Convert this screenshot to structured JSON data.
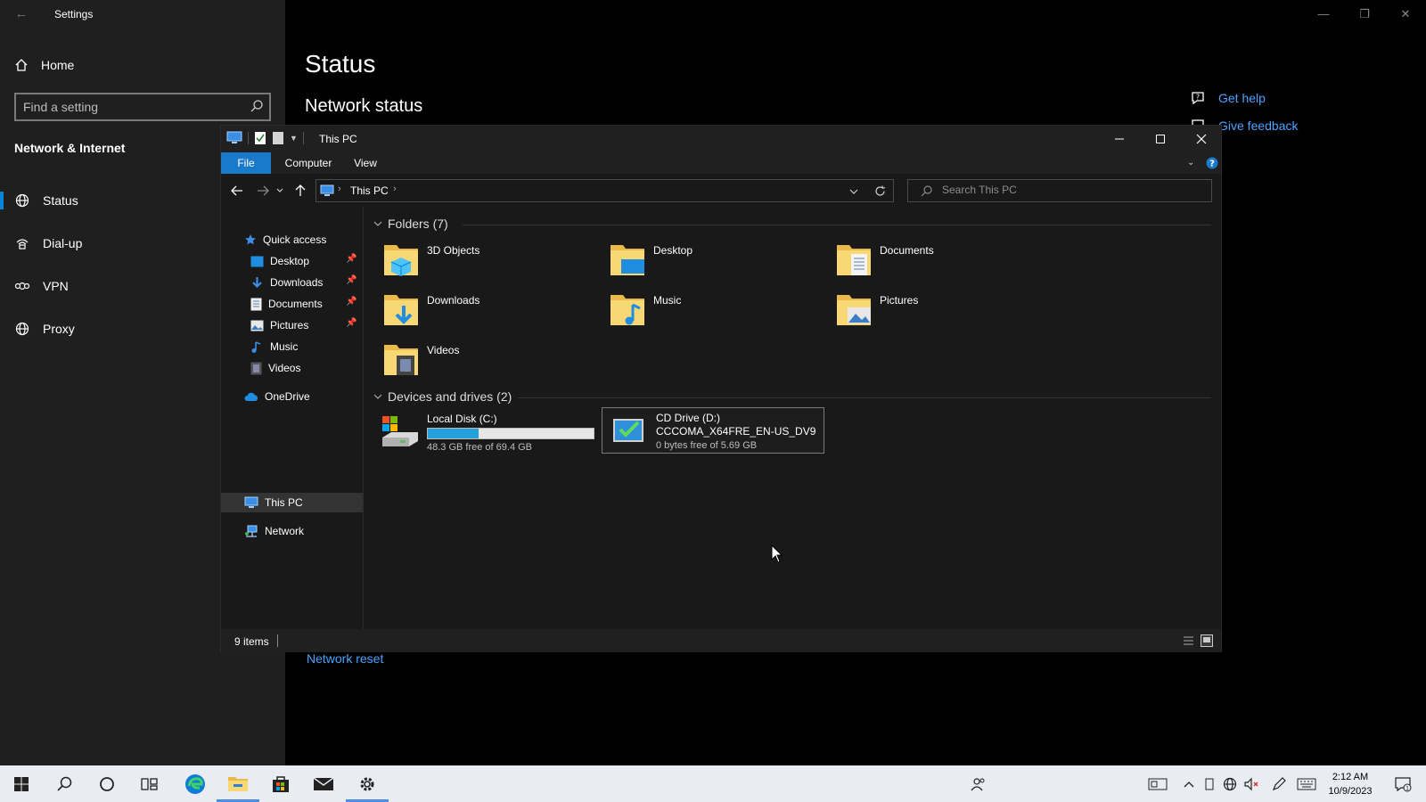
{
  "settings": {
    "title": "Settings",
    "home": "Home",
    "search_placeholder": "Find a setting",
    "section": "Network & Internet",
    "nav": [
      {
        "label": "Status",
        "icon": "globe-icon",
        "active": true
      },
      {
        "label": "Dial-up",
        "icon": "dial-up-icon",
        "active": false
      },
      {
        "label": "VPN",
        "icon": "vpn-icon",
        "active": false
      },
      {
        "label": "Proxy",
        "icon": "globe-icon",
        "active": false
      }
    ],
    "page_title": "Status",
    "subheading": "Network status",
    "get_help": "Get help",
    "give_feedback": "Give feedback",
    "network_reset": "Network reset",
    "accent_color": "#4aa3ff"
  },
  "explorer": {
    "title": "This PC",
    "ribbon_tabs": [
      "File",
      "Computer",
      "View"
    ],
    "address": "This PC",
    "search_placeholder": "Search This PC",
    "tree": {
      "quick_access": "Quick access",
      "quick_items": [
        {
          "label": "Desktop",
          "icon": "desktop-icon",
          "pinned": true
        },
        {
          "label": "Downloads",
          "icon": "downloads-icon",
          "pinned": true
        },
        {
          "label": "Documents",
          "icon": "documents-icon",
          "pinned": true
        },
        {
          "label": "Pictures",
          "icon": "pictures-icon",
          "pinned": true
        },
        {
          "label": "Music",
          "icon": "music-icon",
          "pinned": false
        },
        {
          "label": "Videos",
          "icon": "videos-icon",
          "pinned": false
        }
      ],
      "onedrive": "OneDrive",
      "this_pc": "This PC",
      "network": "Network"
    },
    "folders_header": "Folders (7)",
    "folders": [
      {
        "name": "3D Objects",
        "icon": "3d-objects-folder-icon"
      },
      {
        "name": "Desktop",
        "icon": "desktop-folder-icon"
      },
      {
        "name": "Documents",
        "icon": "documents-folder-icon"
      },
      {
        "name": "Downloads",
        "icon": "downloads-folder-icon"
      },
      {
        "name": "Music",
        "icon": "music-folder-icon"
      },
      {
        "name": "Pictures",
        "icon": "pictures-folder-icon"
      },
      {
        "name": "Videos",
        "icon": "videos-folder-icon"
      }
    ],
    "drives_header": "Devices and drives (2)",
    "drives": [
      {
        "name": "Local Disk (C:)",
        "free": "48.3 GB free of 69.4 GB",
        "used_fraction": 0.304,
        "icon": "hard-drive-icon"
      },
      {
        "name": "CD Drive (D:)",
        "label": "CCCOMA_X64FRE_EN-US_DV9",
        "free": "0 bytes free of 5.69 GB",
        "icon": "cd-drive-icon"
      }
    ],
    "status_text": "9 items"
  },
  "taskbar": {
    "time": "2:12 AM",
    "date": "10/9/2023",
    "apps": [
      "start-icon",
      "search-icon",
      "cortana-icon",
      "task-view-icon",
      "edge-icon",
      "file-explorer-icon",
      "store-icon",
      "mail-icon",
      "settings-icon"
    ]
  }
}
